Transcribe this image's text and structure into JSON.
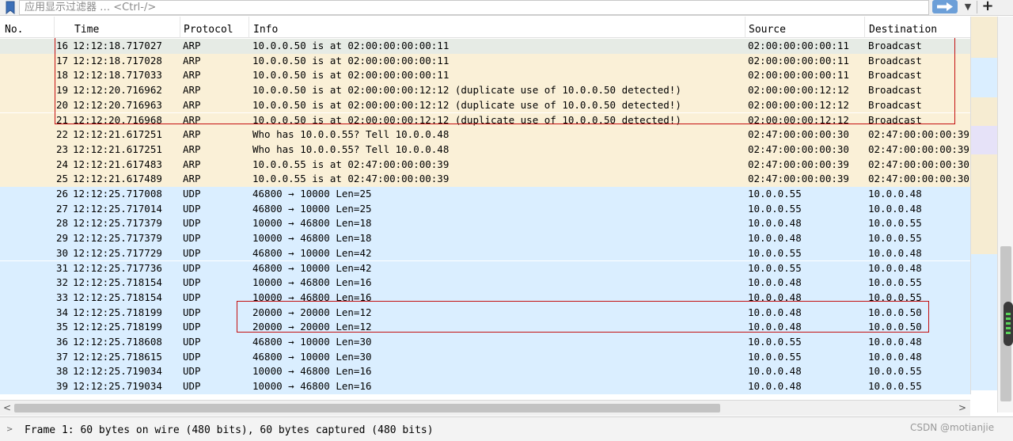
{
  "filter": {
    "placeholder": "应用显示过滤器 … <Ctrl-/>",
    "dropdown_icon": "chevron-down-icon",
    "add_icon": "plus-icon",
    "apply_icon": "arrow-right-icon"
  },
  "columns": {
    "no": "No.",
    "time": "Time",
    "protocol": "Protocol",
    "info": "Info",
    "source": "Source",
    "destination": "Destination"
  },
  "colors": {
    "arp_row": "#faf0d7",
    "udp_row": "#daeeff",
    "selected_row": "#e6ebe5",
    "highlight_box": "#c41010"
  },
  "packets": [
    {
      "no": "16",
      "time": "12:12:18.717027",
      "protocol": "ARP",
      "info": "10.0.0.50 is at 02:00:00:00:00:11",
      "source": "02:00:00:00:00:11",
      "destination": "Broadcast"
    },
    {
      "no": "17",
      "time": "12:12:18.717028",
      "protocol": "ARP",
      "info": "10.0.0.50 is at 02:00:00:00:00:11",
      "source": "02:00:00:00:00:11",
      "destination": "Broadcast"
    },
    {
      "no": "18",
      "time": "12:12:18.717033",
      "protocol": "ARP",
      "info": "10.0.0.50 is at 02:00:00:00:00:11",
      "source": "02:00:00:00:00:11",
      "destination": "Broadcast"
    },
    {
      "no": "19",
      "time": "12:12:20.716962",
      "protocol": "ARP",
      "info": "10.0.0.50 is at 02:00:00:00:12:12 (duplicate use of 10.0.0.50 detected!)",
      "source": "02:00:00:00:12:12",
      "destination": "Broadcast"
    },
    {
      "no": "20",
      "time": "12:12:20.716963",
      "protocol": "ARP",
      "info": "10.0.0.50 is at 02:00:00:00:12:12 (duplicate use of 10.0.0.50 detected!)",
      "source": "02:00:00:00:12:12",
      "destination": "Broadcast"
    },
    {
      "no": "21",
      "time": "12:12:20.716968",
      "protocol": "ARP",
      "info": "10.0.0.50 is at 02:00:00:00:12:12 (duplicate use of 10.0.0.50 detected!)",
      "source": "02:00:00:00:12:12",
      "destination": "Broadcast"
    },
    {
      "no": "22",
      "time": "12:12:21.617251",
      "protocol": "ARP",
      "info": "Who has 10.0.0.55? Tell 10.0.0.48",
      "source": "02:47:00:00:00:30",
      "destination": "02:47:00:00:00:39"
    },
    {
      "no": "23",
      "time": "12:12:21.617251",
      "protocol": "ARP",
      "info": "Who has 10.0.0.55? Tell 10.0.0.48",
      "source": "02:47:00:00:00:30",
      "destination": "02:47:00:00:00:39"
    },
    {
      "no": "24",
      "time": "12:12:21.617483",
      "protocol": "ARP",
      "info": "10.0.0.55 is at 02:47:00:00:00:39",
      "source": "02:47:00:00:00:39",
      "destination": "02:47:00:00:00:30"
    },
    {
      "no": "25",
      "time": "12:12:21.617489",
      "protocol": "ARP",
      "info": "10.0.0.55 is at 02:47:00:00:00:39",
      "source": "02:47:00:00:00:39",
      "destination": "02:47:00:00:00:30"
    },
    {
      "no": "26",
      "time": "12:12:25.717008",
      "protocol": "UDP",
      "info": "46800 → 10000 Len=25",
      "source": "10.0.0.55",
      "destination": "10.0.0.48"
    },
    {
      "no": "27",
      "time": "12:12:25.717014",
      "protocol": "UDP",
      "info": "46800 → 10000 Len=25",
      "source": "10.0.0.55",
      "destination": "10.0.0.48"
    },
    {
      "no": "28",
      "time": "12:12:25.717379",
      "protocol": "UDP",
      "info": "10000 → 46800 Len=18",
      "source": "10.0.0.48",
      "destination": "10.0.0.55"
    },
    {
      "no": "29",
      "time": "12:12:25.717379",
      "protocol": "UDP",
      "info": "10000 → 46800 Len=18",
      "source": "10.0.0.48",
      "destination": "10.0.0.55"
    },
    {
      "no": "30",
      "time": "12:12:25.717729",
      "protocol": "UDP",
      "info": "46800 → 10000 Len=42",
      "source": "10.0.0.55",
      "destination": "10.0.0.48"
    },
    {
      "no": "31",
      "time": "12:12:25.717736",
      "protocol": "UDP",
      "info": "46800 → 10000 Len=42",
      "source": "10.0.0.55",
      "destination": "10.0.0.48"
    },
    {
      "no": "32",
      "time": "12:12:25.718154",
      "protocol": "UDP",
      "info": "10000 → 46800 Len=16",
      "source": "10.0.0.48",
      "destination": "10.0.0.55"
    },
    {
      "no": "33",
      "time": "12:12:25.718154",
      "protocol": "UDP",
      "info": "10000 → 46800 Len=16",
      "source": "10.0.0.48",
      "destination": "10.0.0.55"
    },
    {
      "no": "34",
      "time": "12:12:25.718199",
      "protocol": "UDP",
      "info": "20000 → 20000 Len=12",
      "source": "10.0.0.48",
      "destination": "10.0.0.50"
    },
    {
      "no": "35",
      "time": "12:12:25.718199",
      "protocol": "UDP",
      "info": "20000 → 20000 Len=12",
      "source": "10.0.0.48",
      "destination": "10.0.0.50"
    },
    {
      "no": "36",
      "time": "12:12:25.718608",
      "protocol": "UDP",
      "info": "46800 → 10000 Len=30",
      "source": "10.0.0.55",
      "destination": "10.0.0.48"
    },
    {
      "no": "37",
      "time": "12:12:25.718615",
      "protocol": "UDP",
      "info": "46800 → 10000 Len=30",
      "source": "10.0.0.55",
      "destination": "10.0.0.48"
    },
    {
      "no": "38",
      "time": "12:12:25.719034",
      "protocol": "UDP",
      "info": "10000 → 46800 Len=16",
      "source": "10.0.0.48",
      "destination": "10.0.0.55"
    },
    {
      "no": "39",
      "time": "12:12:25.719034",
      "protocol": "UDP",
      "info": "10000 → 46800 Len=16",
      "source": "10.0.0.48",
      "destination": "10.0.0.55"
    }
  ],
  "status": {
    "frame_details": "Frame 1: 60 bytes on wire (480 bits), 60 bytes captured (480 bits)",
    "expand_icon": "chevron-right-icon",
    "watermark": "CSDN @motianjie"
  },
  "scroll": {
    "left_icon": "chevron-left-icon",
    "right_icon": "chevron-right-icon"
  }
}
